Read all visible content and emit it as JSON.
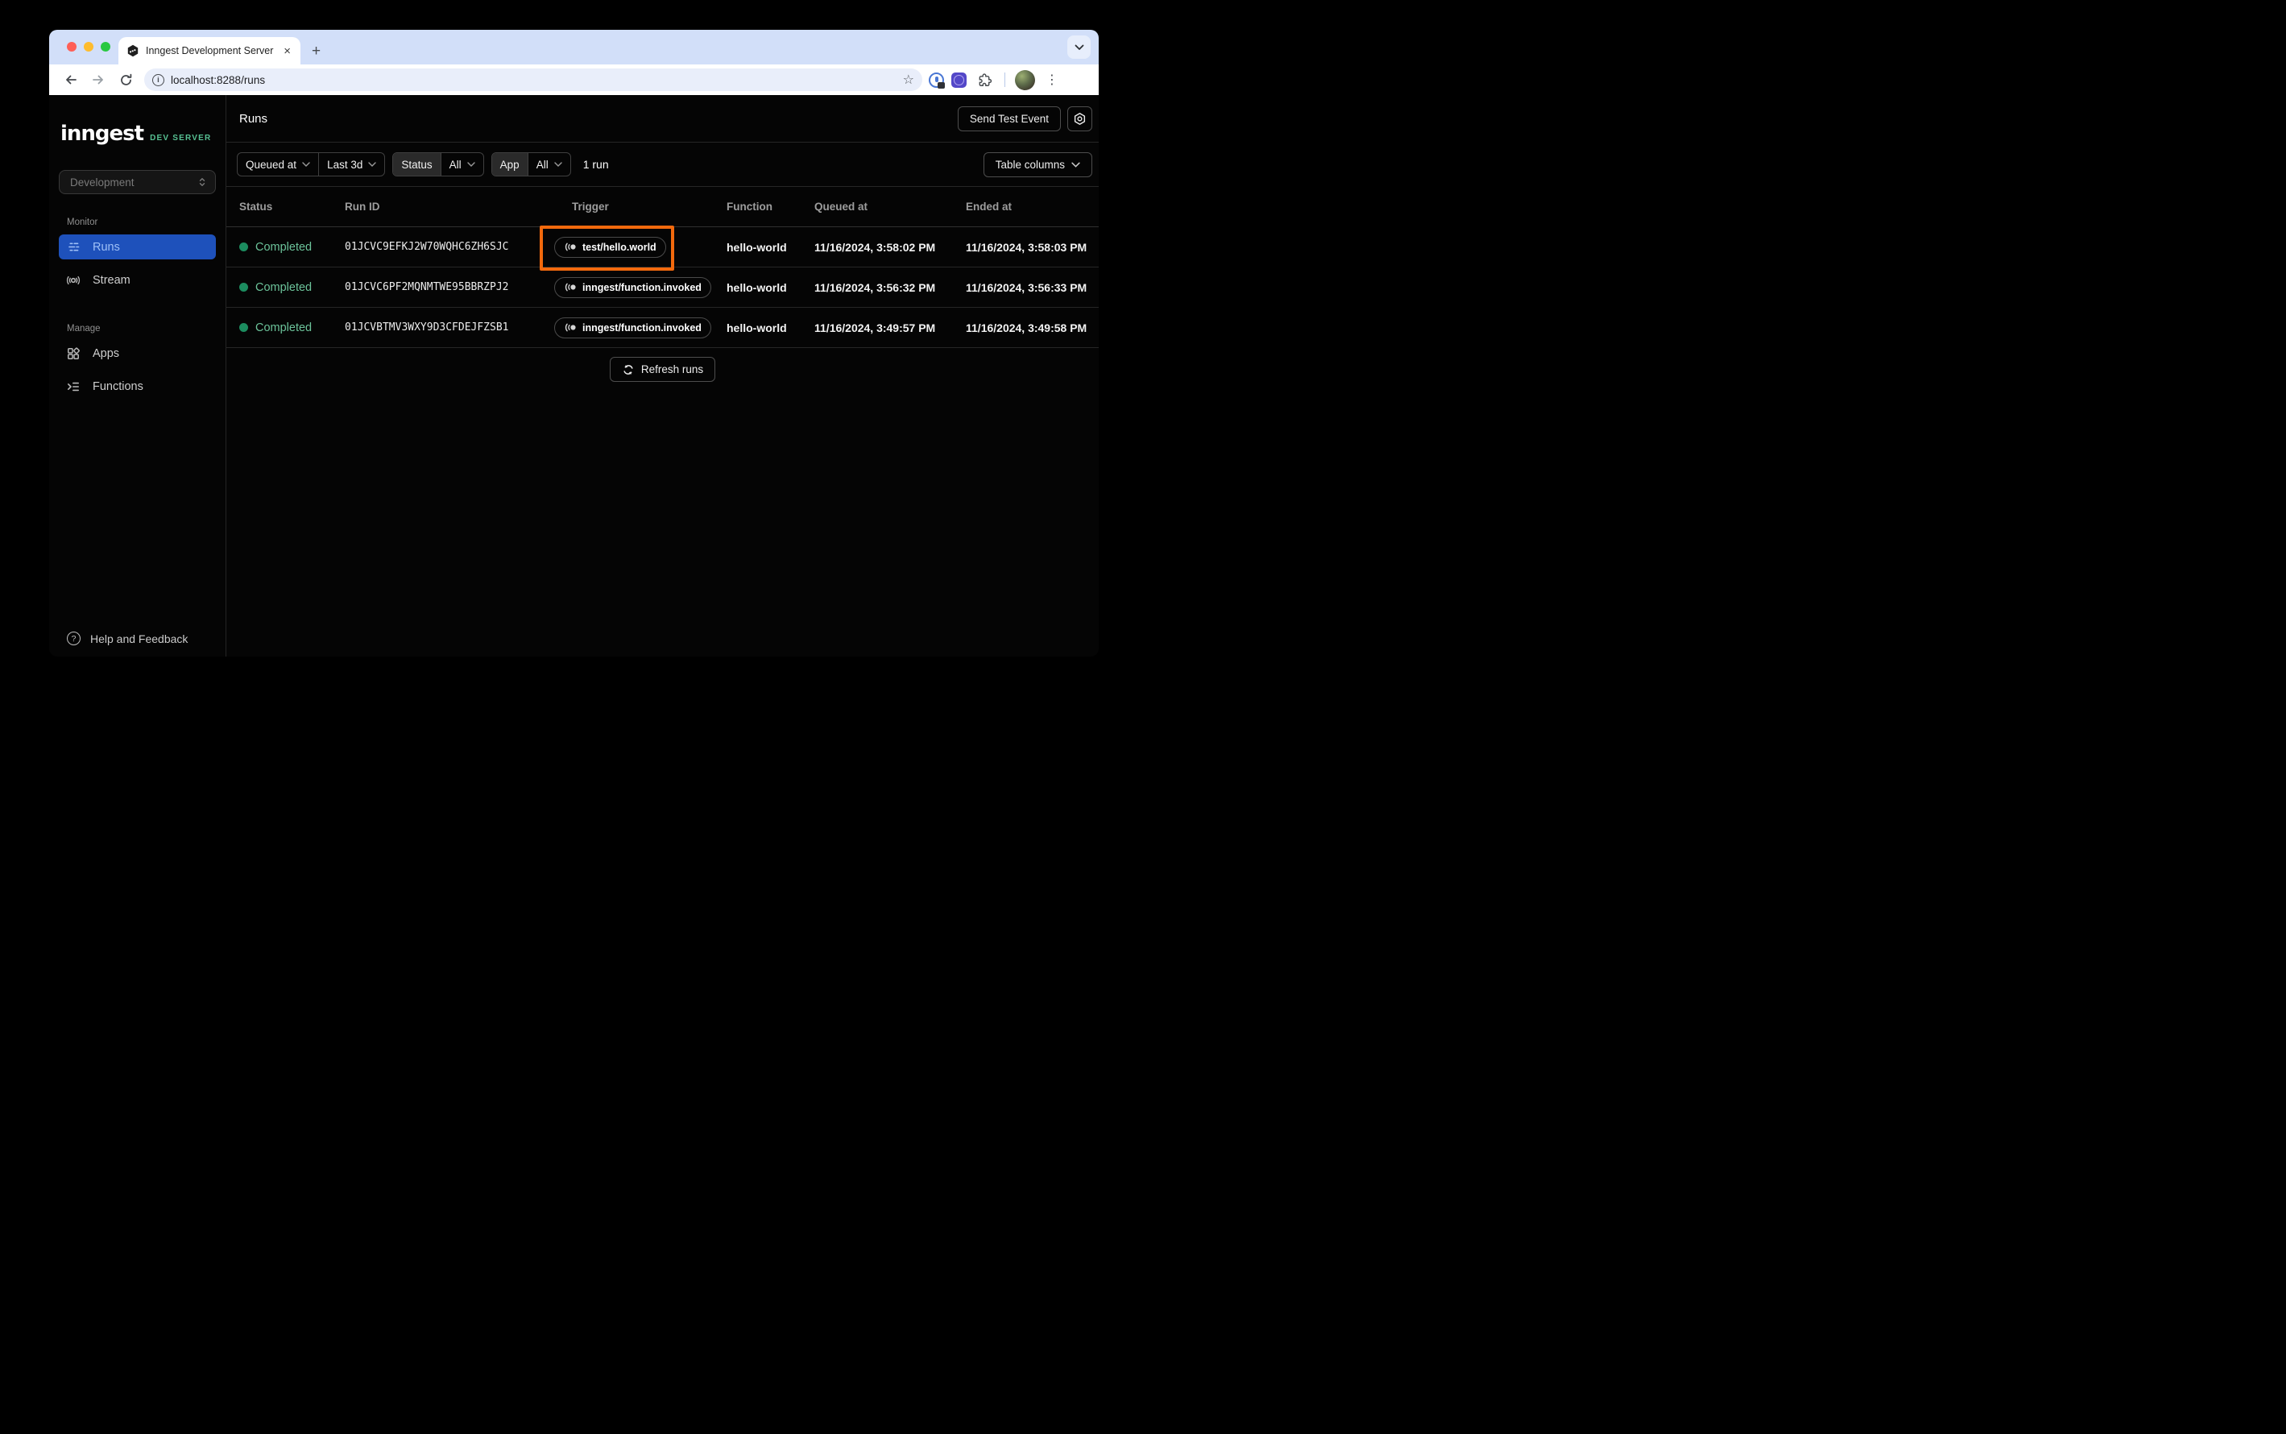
{
  "browser": {
    "tab_title": "Inngest Development Server",
    "url": "localhost:8288/runs",
    "glyphs": {
      "close_tab": "×",
      "new_tab": "+",
      "info": "i",
      "star": "☆",
      "menu": "⋮",
      "help": "?"
    }
  },
  "colors": {
    "accent_blue": "#1e51bb",
    "accent_blue_text": "#9ec0f7",
    "status_green": "#1c8c5f",
    "status_green_text": "#6cc39a",
    "brand_green": "#57c193",
    "highlight_orange": "#f2690d",
    "tabstrip_bg": "#d2dff9",
    "toolbar_bg": "#ffffff",
    "urlbar_bg": "#e9eefa",
    "app_bg": "#050505"
  },
  "sidebar": {
    "logo": "inngest",
    "logo_badge": "DEV SERVER",
    "env_selector": "Development",
    "sections": [
      {
        "label": "Monitor",
        "items": [
          {
            "label": "Runs",
            "active": true
          },
          {
            "label": "Stream",
            "active": false
          }
        ]
      },
      {
        "label": "Manage",
        "items": [
          {
            "label": "Apps",
            "active": false
          },
          {
            "label": "Functions",
            "active": false
          }
        ]
      }
    ],
    "footer": {
      "help_label": "Help and Feedback"
    }
  },
  "header": {
    "title": "Runs",
    "send_test_event_label": "Send Test Event"
  },
  "filters": {
    "field_label": "Queued at",
    "range_label": "Last 3d",
    "status_label": "Status",
    "status_value": "All",
    "app_label": "App",
    "app_value": "All",
    "run_count": "1 run",
    "table_columns_label": "Table columns"
  },
  "table": {
    "columns": [
      "Status",
      "Run ID",
      "Trigger",
      "Function",
      "Queued at",
      "Ended at"
    ],
    "rows": [
      {
        "status": "Completed",
        "run_id": "01JCVC9EFKJ2W70WQHC6ZH6SJC",
        "trigger": "test/hello.world",
        "function": "hello-world",
        "queued_at": "11/16/2024, 3:58:02 PM",
        "ended_at": "11/16/2024, 3:58:03 PM",
        "highlighted": true
      },
      {
        "status": "Completed",
        "run_id": "01JCVC6PF2MQNMTWE95BBRZPJ2",
        "trigger": "inngest/function.invoked",
        "function": "hello-world",
        "queued_at": "11/16/2024, 3:56:32 PM",
        "ended_at": "11/16/2024, 3:56:33 PM",
        "highlighted": false
      },
      {
        "status": "Completed",
        "run_id": "01JCVBTMV3WXY9D3CFDEJFZSB1",
        "trigger": "inngest/function.invoked",
        "function": "hello-world",
        "queued_at": "11/16/2024, 3:49:57 PM",
        "ended_at": "11/16/2024, 3:49:58 PM",
        "highlighted": false
      }
    ],
    "refresh_label": "Refresh runs"
  }
}
